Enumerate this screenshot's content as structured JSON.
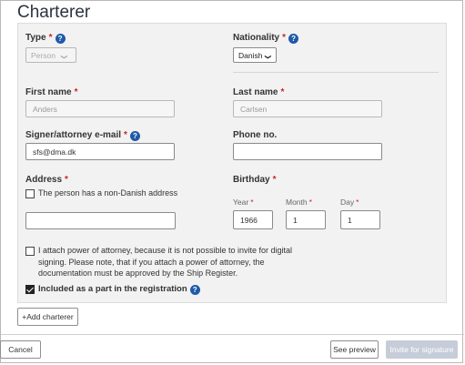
{
  "section": {
    "title": "Charterer"
  },
  "type": {
    "label": "Type",
    "required": "*",
    "value": "Person"
  },
  "nationality": {
    "label": "Nationality",
    "required": "*",
    "value": "Danish"
  },
  "first_name": {
    "label": "First name",
    "required": "*",
    "value": "Anders"
  },
  "last_name": {
    "label": "Last name",
    "required": "*",
    "value": "Carlsen"
  },
  "signer_email": {
    "label": "Signer/attorney e-mail",
    "required": "*",
    "value": "sfs@dma.dk"
  },
  "phone": {
    "label": "Phone no.",
    "value": ""
  },
  "address": {
    "label": "Address",
    "required": "*",
    "non_danish_label": "The person has a non-Danish address",
    "non_danish_checked": false,
    "value": ""
  },
  "birthday": {
    "label": "Birthday",
    "required": "*",
    "year_label": "Year",
    "month_label": "Month",
    "day_label": "Day",
    "year": "1966",
    "month": "1",
    "day": "1"
  },
  "power_of_attorney": {
    "text": "I attach power of attorney, because it is not possible to invite for digital signing. Please note, that if you attach a power of attorney, the documentation must be approved by the Ship Register.",
    "checked": false
  },
  "included": {
    "label": "Included as a part in the registration",
    "checked": true
  },
  "buttons": {
    "add_charterer": "+Add charterer",
    "cancel": "Cancel",
    "see_preview": "See preview",
    "invite": "Invite for signature"
  },
  "icons": {
    "help": "help-circle-icon",
    "caret": "chevron-down-icon"
  },
  "colors": {
    "help_icon": "#1f5aa8",
    "required": "#c62828",
    "highlight": "#e0474c"
  }
}
